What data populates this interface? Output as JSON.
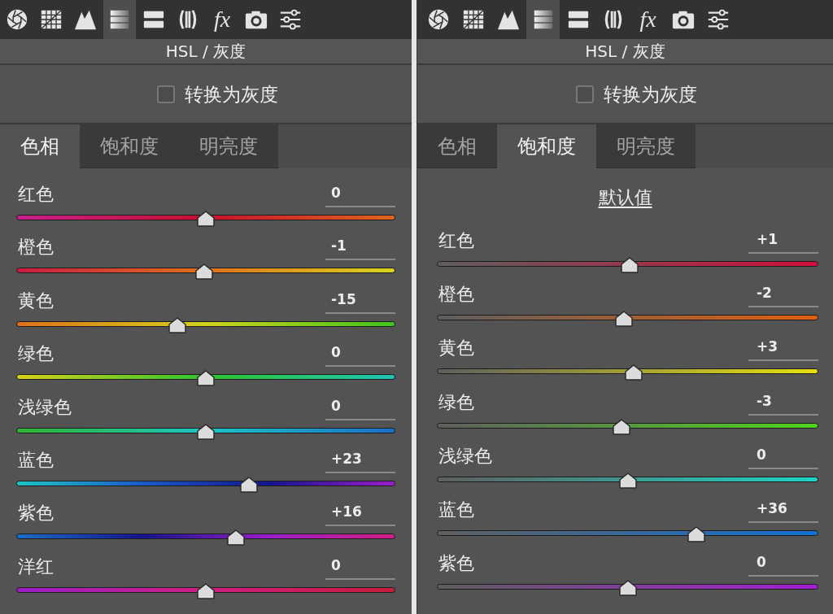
{
  "panels": [
    {
      "toolbar": [
        {
          "selected": false
        },
        {
          "selected": false
        },
        {
          "selected": false
        },
        {
          "selected": true
        },
        {
          "selected": false
        },
        {
          "selected": false
        },
        {
          "label": "fx",
          "selected": false
        },
        {
          "selected": false
        },
        {
          "selected": false
        }
      ],
      "title": "HSL / 灰度",
      "grayscale": {
        "label": "转换为灰度",
        "checked": false
      },
      "tabs": [
        {
          "label": "色相",
          "selected": true
        },
        {
          "label": "饱和度",
          "selected": false
        },
        {
          "label": "明亮度",
          "selected": false
        }
      ],
      "sliders": [
        {
          "label": "红色",
          "reading": "0",
          "level": 0.5
        },
        {
          "label": "橙色",
          "reading": "-1",
          "level": 0.495
        },
        {
          "label": "黄色",
          "reading": "-15",
          "level": 0.425
        },
        {
          "label": "绿色",
          "reading": "0",
          "level": 0.5
        },
        {
          "label": "浅绿色",
          "reading": "0",
          "level": 0.5
        },
        {
          "label": "蓝色",
          "reading": "+23",
          "level": 0.615
        },
        {
          "label": "紫色",
          "reading": "+16",
          "level": 0.58
        },
        {
          "label": "洋红",
          "reading": "0",
          "level": 0.5
        }
      ]
    },
    {
      "toolbar": [
        {
          "selected": false
        },
        {
          "selected": false
        },
        {
          "selected": false
        },
        {
          "selected": true
        },
        {
          "selected": false
        },
        {
          "selected": false
        },
        {
          "label": "fx",
          "selected": false
        },
        {
          "selected": false
        },
        {
          "selected": false
        }
      ],
      "title": "HSL / 灰度",
      "grayscale": {
        "label": "转换为灰度",
        "checked": false
      },
      "tabs": [
        {
          "label": "色相",
          "selected": false
        },
        {
          "label": "饱和度",
          "selected": true
        },
        {
          "label": "明亮度",
          "selected": false
        }
      ],
      "defaults_link": "默认值",
      "sliders": [
        {
          "label": "红色",
          "reading": "+1",
          "level": 0.505
        },
        {
          "label": "橙色",
          "reading": "-2",
          "level": 0.49
        },
        {
          "label": "黄色",
          "reading": "+3",
          "level": 0.515
        },
        {
          "label": "绿色",
          "reading": "-3",
          "level": 0.485
        },
        {
          "label": "浅绿色",
          "reading": "0",
          "level": 0.5
        },
        {
          "label": "蓝色",
          "reading": "+36",
          "level": 0.68
        },
        {
          "label": "紫色",
          "reading": "0",
          "level": 0.5
        }
      ]
    }
  ]
}
